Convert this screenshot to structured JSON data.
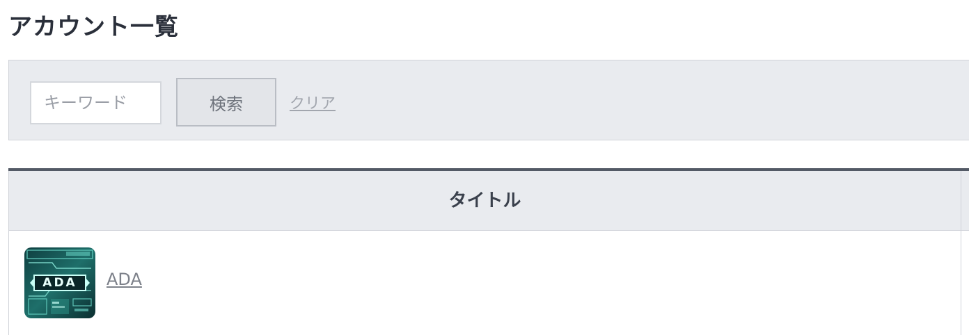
{
  "page": {
    "title": "アカウント一覧"
  },
  "search": {
    "placeholder": "キーワード",
    "value": "",
    "button_label": "検索",
    "clear_label": "クリア"
  },
  "table": {
    "columns": [
      "タイトル"
    ],
    "rows": [
      {
        "thumbnail_text": "ADA",
        "title": "ADA"
      }
    ]
  },
  "colors": {
    "panel_bg": "#e9ebef",
    "header_border": "#535a66",
    "link": "#7d818a",
    "thumb_teal": "#3fb6a8"
  }
}
